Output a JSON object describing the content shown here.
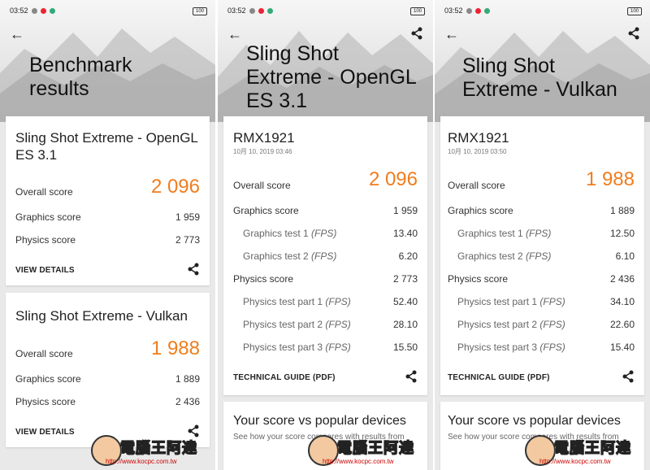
{
  "status_bar": {
    "time": "03:52",
    "battery": "100"
  },
  "accent_color": "#f07d1e",
  "panel1": {
    "title_line1": "Benchmark",
    "title_line2": "results",
    "card1": {
      "title_line1": "Sling Shot Extreme - OpenGL",
      "title_line2": "ES 3.1",
      "overall_label": "Overall score",
      "overall_value": "2 096",
      "graphics_label": "Graphics score",
      "graphics_value": "1 959",
      "physics_label": "Physics score",
      "physics_value": "2 773",
      "link": "VIEW DETAILS"
    },
    "card2": {
      "title": "Sling Shot Extreme - Vulkan",
      "overall_label": "Overall score",
      "overall_value": "1 988",
      "graphics_label": "Graphics score",
      "graphics_value": "1 889",
      "physics_label": "Physics score",
      "physics_value": "2 436",
      "link": "VIEW DETAILS"
    }
  },
  "panel2": {
    "title_line1": "Sling Shot",
    "title_line2": "Extreme - OpenGL",
    "title_line3": "ES 3.1",
    "device": "RMX1921",
    "date": "10月 10, 2019 03:46",
    "overall_label": "Overall score",
    "overall_value": "2 096",
    "graphics_label": "Graphics score",
    "graphics_value": "1 959",
    "gt1_label": "Graphics test 1",
    "gt1_value": "13.40",
    "gt2_label": "Graphics test 2",
    "gt2_value": "6.20",
    "physics_label": "Physics score",
    "physics_value": "2 773",
    "pt1_label": "Physics test part 1",
    "pt1_value": "52.40",
    "pt2_label": "Physics test part 2",
    "pt2_value": "28.10",
    "pt3_label": "Physics test part 3",
    "pt3_value": "15.50",
    "fps_unit": "(FPS)",
    "link": "TECHNICAL GUIDE (PDF)",
    "popular_title": "Your score vs popular devices",
    "popular_sub": "See how your score compares with results from"
  },
  "panel3": {
    "title_line1": "Sling Shot",
    "title_line2": "Extreme - Vulkan",
    "device": "RMX1921",
    "date": "10月 10, 2019 03:50",
    "overall_label": "Overall score",
    "overall_value": "1 988",
    "graphics_label": "Graphics score",
    "graphics_value": "1 889",
    "gt1_label": "Graphics test 1",
    "gt1_value": "12.50",
    "gt2_label": "Graphics test 2",
    "gt2_value": "6.10",
    "physics_label": "Physics score",
    "physics_value": "2 436",
    "pt1_label": "Physics test part 1",
    "pt1_value": "34.10",
    "pt2_label": "Physics test part 2",
    "pt2_value": "22.60",
    "pt3_label": "Physics test part 3",
    "pt3_value": "15.40",
    "fps_unit": "(FPS)",
    "link": "TECHNICAL GUIDE (PDF)",
    "popular_title": "Your score vs popular devices",
    "popular_sub": "See how your score compares with results from"
  },
  "watermark": {
    "text": "電腦王阿達",
    "url": "http://www.kocpc.com.tw"
  }
}
